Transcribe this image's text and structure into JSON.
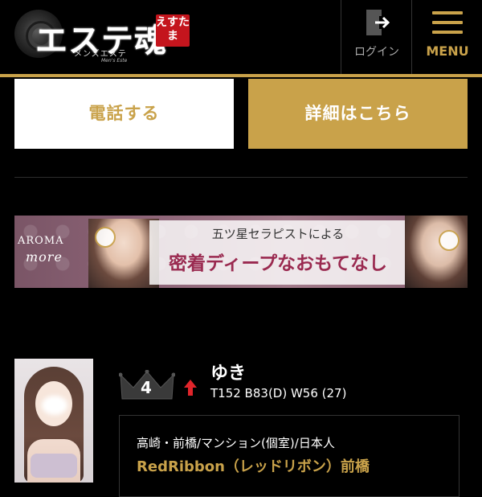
{
  "header": {
    "logo_text": "エステ魂",
    "logo_stamp": "えすたま",
    "logo_subtitle": "メンズエステ",
    "logo_subtitle_en": "Men's Este",
    "login_label": "ログイン",
    "menu_label": "MENU"
  },
  "actions": {
    "call_label": "電話する",
    "detail_label": "詳細はこちら"
  },
  "banner": {
    "brand_line1": "AROMA",
    "brand_line2": "more",
    "line1": "五ツ星セラピストによる",
    "line2": "密着ディープなおもてなし"
  },
  "listing": {
    "rank": "4",
    "rank_trend": "up",
    "name": "ゆき",
    "stats": "T152 B83(D) W56 (27)",
    "area": "高崎・前橋/マンション(個室)/日本人",
    "shop": "RedRibbon（レッドリボン）前橋"
  },
  "colors": {
    "accent_gold": "#c9a24a",
    "background": "#000000",
    "rank_arrow": "#e0252b",
    "stamp_red": "#c4151d"
  }
}
